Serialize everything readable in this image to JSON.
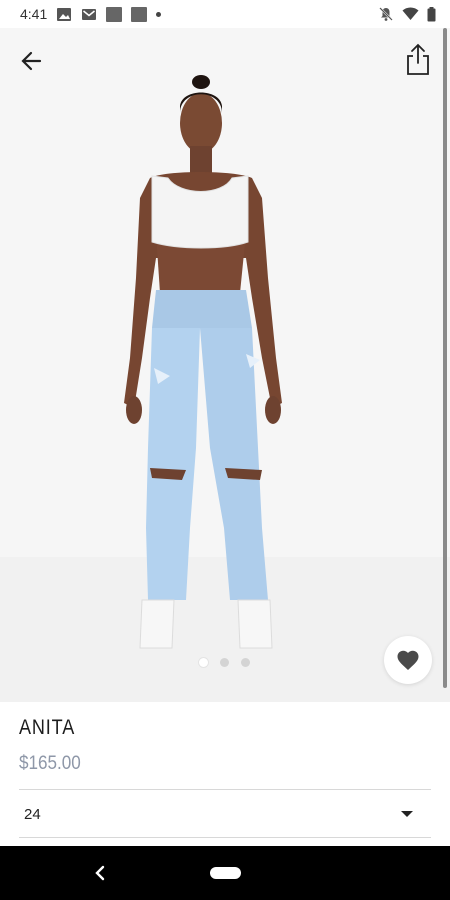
{
  "status_bar": {
    "time": "4:41",
    "left_icons": [
      "image-icon",
      "gmail-icon",
      "app-square-icon",
      "app-square-icon",
      "notification-dot-icon"
    ],
    "right_icons": [
      "bell-off-icon",
      "wifi-icon",
      "battery-icon"
    ]
  },
  "header": {
    "back_icon": "arrow-left-icon",
    "share_icon": "share-icon"
  },
  "gallery": {
    "image_count": 3,
    "active_index": 0
  },
  "favorite": {
    "icon": "heart-icon"
  },
  "product": {
    "name": "ANITA",
    "price": "$165.00"
  },
  "size_selector": {
    "selected_value": "24",
    "icon": "caret-down-icon"
  },
  "colors": {
    "price": "#8e97a8",
    "nav_bar": "#000000",
    "hero_bg": "#f6f6f6"
  }
}
